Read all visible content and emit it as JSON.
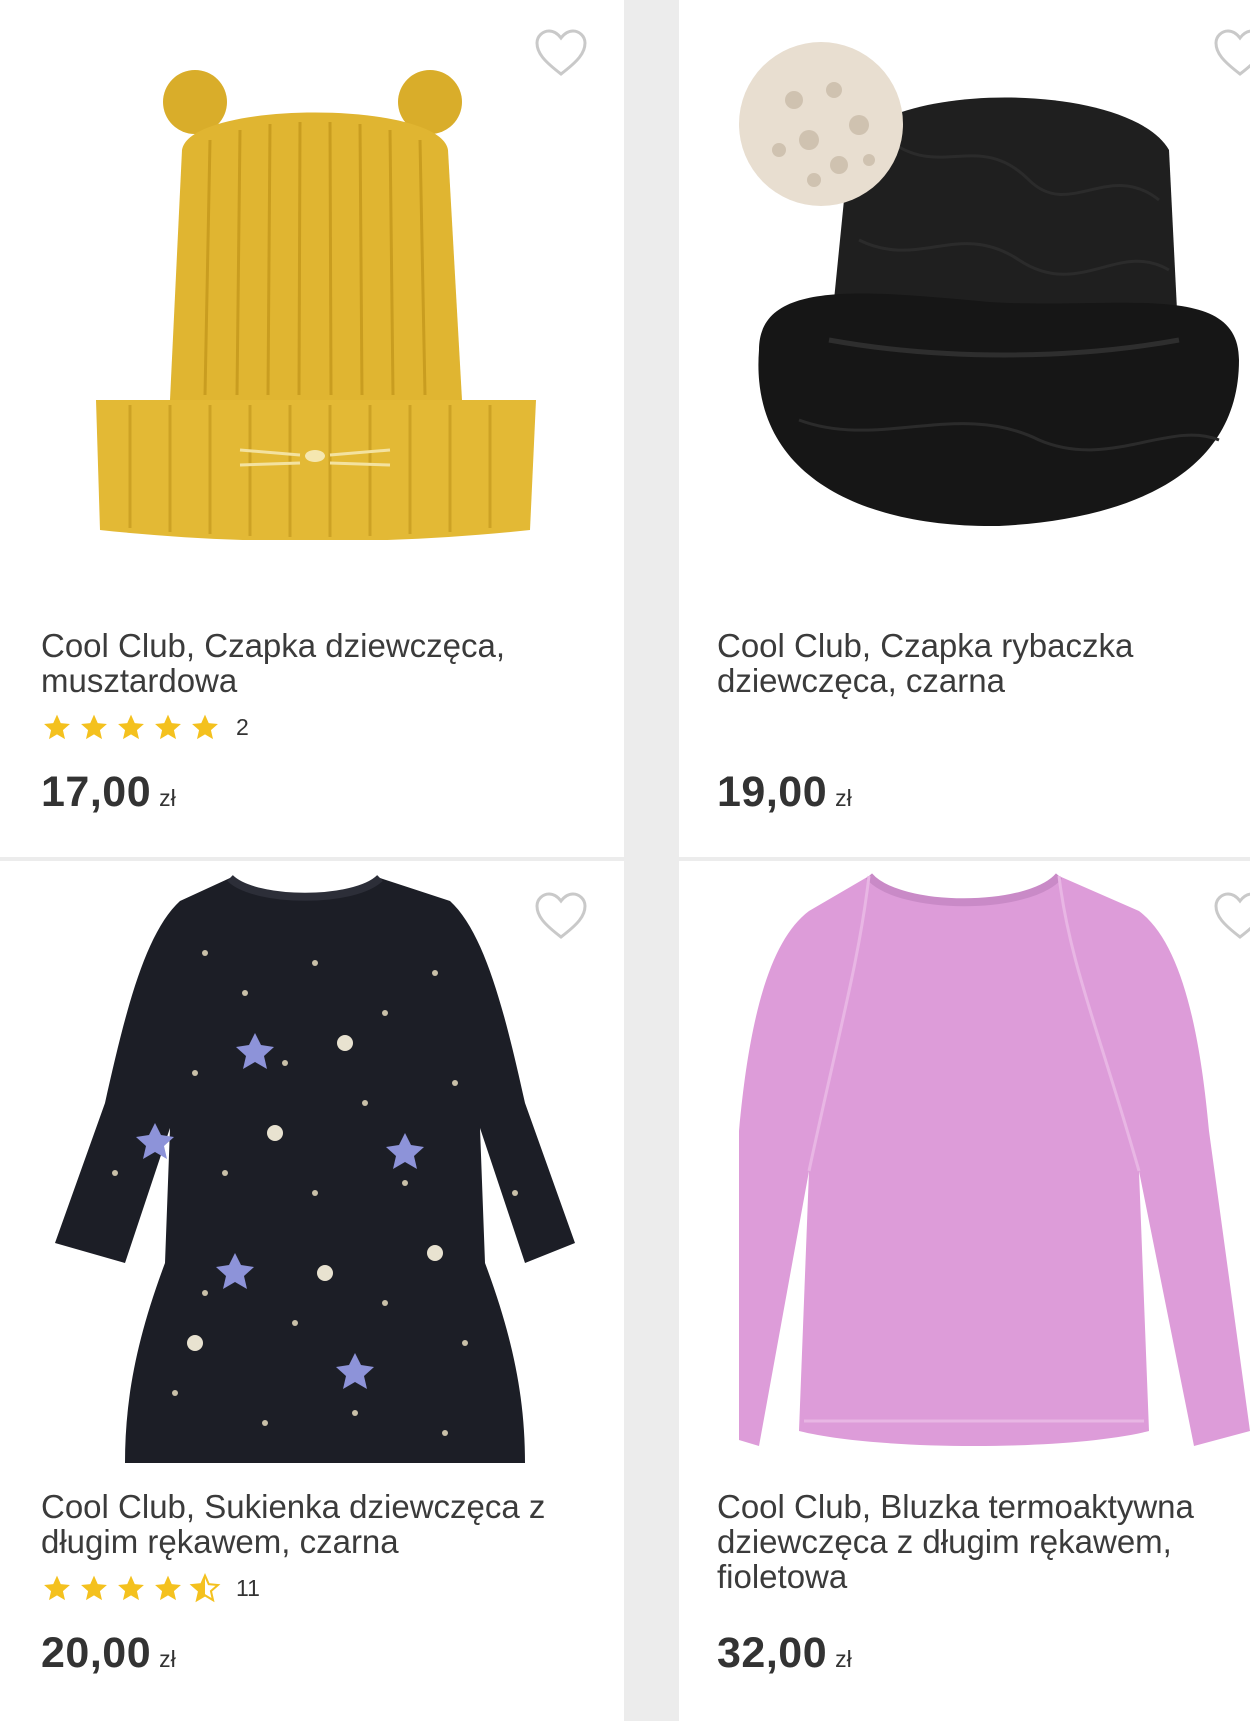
{
  "products": [
    {
      "title_lines": [
        "Cool Club, Czapka dziewczęca,",
        "musztardowa"
      ],
      "rating_count": "2",
      "rating_value": 5,
      "price": "17,00",
      "currency": "zł",
      "image_icon": "mustard-knit-beanie-image"
    },
    {
      "title_lines": [
        "Cool Club, Czapka rybaczka",
        "dziewczęca, czarna"
      ],
      "price": "19,00",
      "currency": "zł",
      "image_icon": "black-bucket-hat-image"
    },
    {
      "title_lines": [
        "Cool Club, Sukienka dziewczęca z",
        "długim rękawem, czarna"
      ],
      "rating_count": "11",
      "rating_value": 4.5,
      "price": "20,00",
      "currency": "zł",
      "image_icon": "starry-black-dress-image"
    },
    {
      "title_lines": [
        "Cool Club, Bluzka termoaktywna",
        "dziewczęca z długim rękawem,",
        "fioletowa"
      ],
      "price": "32,00",
      "currency": "zł",
      "image_icon": "pink-thermal-top-image"
    }
  ],
  "colors": {
    "star": "#f4c11e",
    "heart_outline": "#c9c9c9",
    "text": "#3b3b3b"
  }
}
